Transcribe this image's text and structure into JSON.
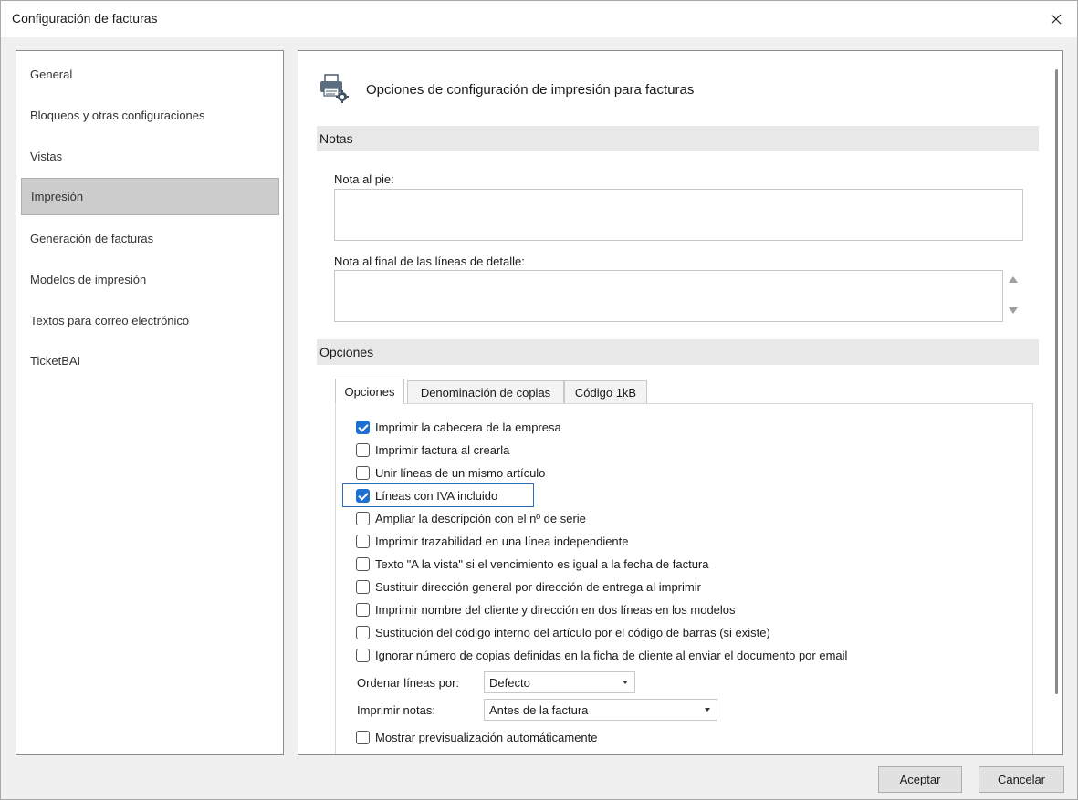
{
  "window": {
    "title": "Configuración de facturas"
  },
  "nav": {
    "items": [
      {
        "label": "General"
      },
      {
        "label": "Bloqueos y otras configuraciones"
      },
      {
        "label": "Vistas"
      },
      {
        "label": "Impresión",
        "selected": true
      },
      {
        "label": "Generación de facturas"
      },
      {
        "label": "Modelos de impresión"
      },
      {
        "label": "Textos para correo electrónico"
      },
      {
        "label": "TicketBAI"
      }
    ]
  },
  "content": {
    "header_title": "Opciones de configuración de impresión para facturas",
    "header_icon": "printer-settings-icon",
    "notas_section": "Notas",
    "nota_pie_label": "Nota al pie:",
    "nota_pie_value": "",
    "nota_final_label": "Nota al final de las líneas de detalle:",
    "nota_final_value": "",
    "opciones_section": "Opciones",
    "tabs": [
      {
        "label": "Opciones",
        "active": true
      },
      {
        "label": "Denominación de copias"
      },
      {
        "label": "Código 1kB"
      }
    ],
    "checkboxes": [
      {
        "label": "Imprimir la cabecera de la empresa",
        "checked": true
      },
      {
        "label": "Imprimir factura al crearla",
        "checked": false
      },
      {
        "label": "Unir líneas de un mismo artículo",
        "checked": false
      },
      {
        "label": "Líneas con IVA incluido",
        "checked": true,
        "focused": true
      },
      {
        "label": "Ampliar la descripción con el nº de serie",
        "checked": false
      },
      {
        "label": "Imprimir trazabilidad en una línea independiente",
        "checked": false
      },
      {
        "label": "Texto \"A la vista\" si el vencimiento es igual a la fecha de factura",
        "checked": false
      },
      {
        "label": "Sustituir dirección general por dirección de entrega al imprimir",
        "checked": false
      },
      {
        "label": "Imprimir nombre del cliente y dirección en dos líneas en los modelos",
        "checked": false
      },
      {
        "label": "Sustitución del código interno del artículo por el código de barras (si existe)",
        "checked": false
      },
      {
        "label": "Ignorar número de copias definidas en la ficha de cliente al enviar el documento por email",
        "checked": false
      }
    ],
    "ordenar_label": "Ordenar líneas por:",
    "ordenar_value": "Defecto",
    "imprimir_notas_label": "Imprimir notas:",
    "imprimir_notas_value": "Antes de la factura",
    "preview_checkbox": {
      "label": "Mostrar previsualización automáticamente",
      "checked": false
    }
  },
  "footer": {
    "accept_label": "Aceptar",
    "cancel_label": "Cancelar"
  },
  "colors": {
    "accent": "#1f6fd1",
    "selected_nav": "#cccccc",
    "section_bar": "#e8e8e8"
  }
}
